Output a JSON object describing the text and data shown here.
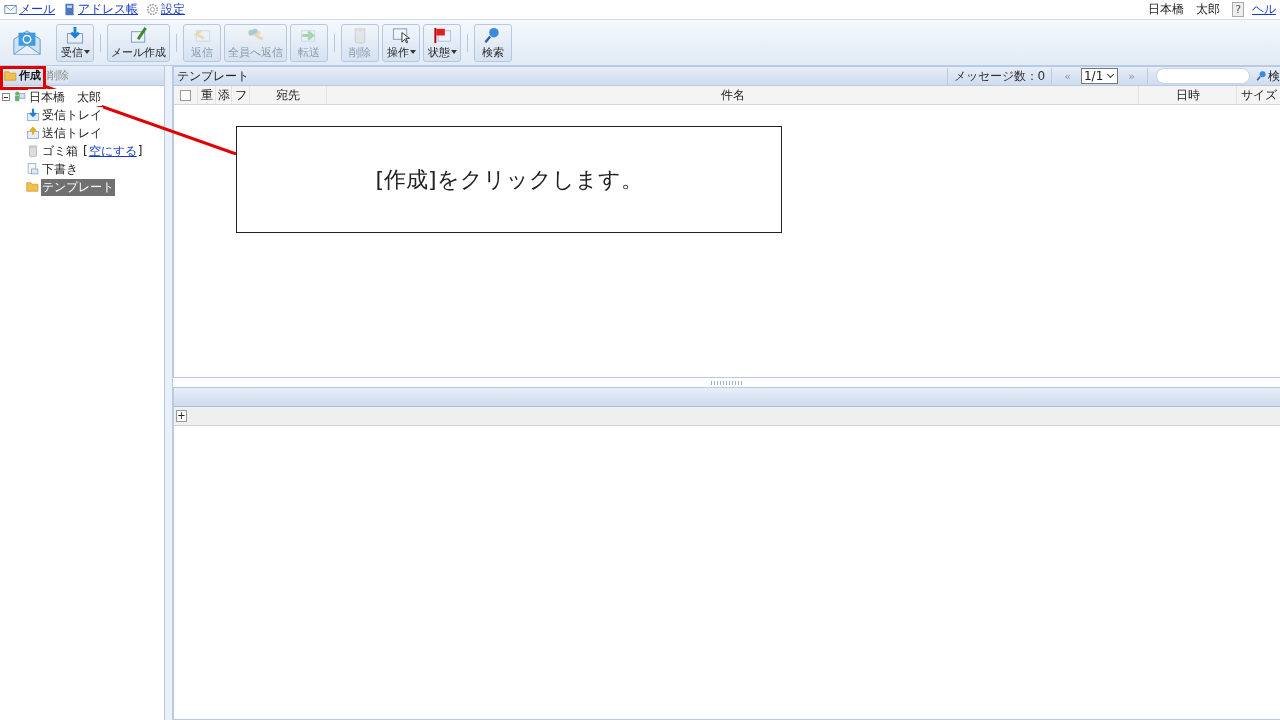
{
  "top_nav": {
    "links": [
      {
        "label": "メール"
      },
      {
        "label": "アドレス帳"
      },
      {
        "label": "設定"
      }
    ],
    "user": "日本橋　太郎",
    "help": {
      "mark": "?",
      "label": "ヘル"
    }
  },
  "toolbar": {
    "groups": [
      [
        {
          "kind": "logo"
        }
      ],
      [
        {
          "kind": "button",
          "label": "受信",
          "disabled": false,
          "caret": true
        }
      ],
      [
        {
          "kind": "button",
          "label": "メール作成",
          "disabled": false,
          "caret": false
        }
      ],
      [
        {
          "kind": "button",
          "label": "返信",
          "disabled": true,
          "caret": false
        },
        {
          "kind": "button",
          "label": "全員へ返信",
          "disabled": true,
          "caret": false
        },
        {
          "kind": "button",
          "label": "転送",
          "disabled": true,
          "caret": false
        }
      ],
      [
        {
          "kind": "button",
          "label": "削除",
          "disabled": true,
          "caret": false
        },
        {
          "kind": "button",
          "label": "操作",
          "disabled": false,
          "caret": true
        },
        {
          "kind": "button",
          "label": "状態",
          "disabled": false,
          "caret": true
        }
      ],
      [
        {
          "kind": "button",
          "label": "検索",
          "disabled": false,
          "caret": false
        }
      ]
    ]
  },
  "folder_pane": {
    "actions": [
      {
        "label": "作成",
        "disabled": false
      },
      {
        "label": "削除",
        "disabled": true
      }
    ],
    "tree": [
      {
        "label": "日本橋　太郎",
        "expanded": true,
        "selected": false,
        "children": [
          {
            "label": "受信トレイ",
            "selected": false
          },
          {
            "label": "送信トレイ",
            "selected": false
          },
          {
            "label": "ゴミ箱",
            "selected": false,
            "link_open": "[",
            "link": "空にする",
            "link_close": "]"
          },
          {
            "label": "下書き",
            "selected": false
          },
          {
            "label": "テンプレート",
            "selected": true
          }
        ]
      }
    ]
  },
  "message_list": {
    "title": "テンプレート",
    "message_count": "メッセージ数：0",
    "prev": "«",
    "page": "1/1",
    "next": "»",
    "search_button": "検",
    "columns": [
      {
        "kind": "check",
        "checked": false
      },
      {
        "kind": "text",
        "label": "重"
      },
      {
        "kind": "text",
        "label": "添"
      },
      {
        "kind": "text",
        "label": "フ"
      },
      {
        "kind": "text",
        "label": "宛先"
      },
      {
        "kind": "text",
        "label": "件名"
      },
      {
        "kind": "text",
        "label": "日時"
      },
      {
        "kind": "text",
        "label": "サイズ"
      }
    ]
  },
  "preview": {
    "expand_button": "+"
  },
  "callout": {
    "text": "[作成]をクリックします。"
  }
}
